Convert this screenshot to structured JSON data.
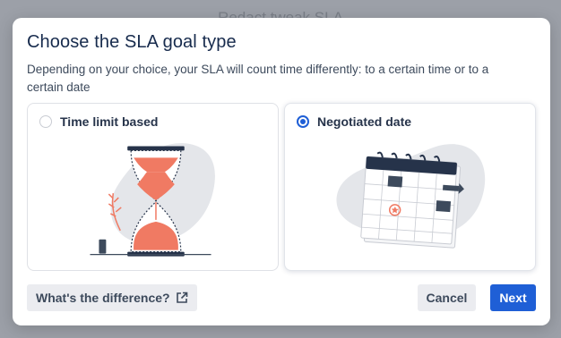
{
  "modal": {
    "title": "Choose the SLA goal type",
    "description": "Depending on your choice, your SLA will count time differently: to a certain time or to a certain date"
  },
  "options": [
    {
      "label": "Time limit based",
      "selected": false,
      "illustration": "hourglass-illustration"
    },
    {
      "label": "Negotiated date",
      "selected": true,
      "illustration": "calendar-illustration"
    }
  ],
  "footer": {
    "difference_label": "What's the difference?",
    "difference_icon": "external-link-icon",
    "cancel_label": "Cancel",
    "next_label": "Next"
  },
  "colors": {
    "primary": "#1f5fd6",
    "accent": "#f07a63",
    "title": "#172b4d"
  }
}
